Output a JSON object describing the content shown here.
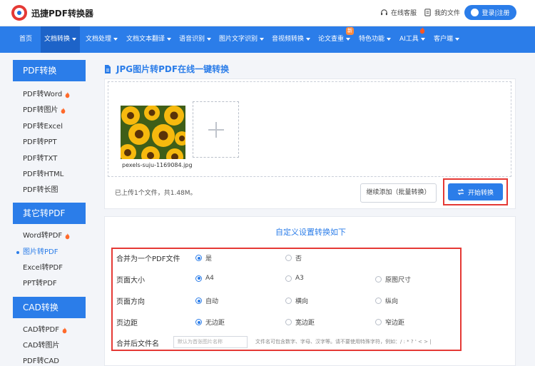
{
  "header": {
    "logo_text": "迅捷PDF转换器",
    "service_label": "在线客服",
    "my_files_label": "我的文件",
    "login_label": "登录|注册"
  },
  "nav": {
    "items": [
      {
        "label": "首页"
      },
      {
        "label": "文档转换"
      },
      {
        "label": "文档处理"
      },
      {
        "label": "文档文本翻译"
      },
      {
        "label": "语音识别"
      },
      {
        "label": "图片文字识别"
      },
      {
        "label": "音视频转换"
      },
      {
        "label": "论文查重"
      },
      {
        "label": "特色功能"
      },
      {
        "label": "AI工具"
      },
      {
        "label": "客户端"
      }
    ],
    "new_badge": "新"
  },
  "sidebar": {
    "sections": [
      {
        "title": "PDF转换",
        "items": [
          "PDF转Word",
          "PDF转图片",
          "PDF转Excel",
          "PDF转PPT",
          "PDF转TXT",
          "PDF转HTML",
          "PDF转长图"
        ]
      },
      {
        "title": "其它转PDF",
        "items": [
          "Word转PDF",
          "图片转PDF",
          "Excel转PDF",
          "PPT转PDF"
        ]
      },
      {
        "title": "CAD转换",
        "items": [
          "CAD转PDF",
          "CAD转图片",
          "PDF转CAD"
        ]
      }
    ]
  },
  "main": {
    "title": "JPG图片转PDF在线一键转换",
    "file_name": "pexels-suju-1169084.jpg",
    "upload_info": "已上传1个文件，共1.48M。",
    "continue_label": "继续添加（批量转换）",
    "start_label": "开始转换"
  },
  "settings": {
    "title": "自定义设置转换如下",
    "rows": [
      {
        "label": "合并为一个PDF文件",
        "options": [
          "是",
          "否"
        ]
      },
      {
        "label": "页面大小",
        "options": [
          "A4",
          "A3",
          "原图尺寸"
        ]
      },
      {
        "label": "页面方向",
        "options": [
          "自动",
          "横向",
          "纵向"
        ]
      },
      {
        "label": "页边距",
        "options": [
          "无边距",
          "宽边距",
          "窄边距"
        ]
      }
    ],
    "filename_label": "合并后文件名",
    "filename_placeholder": "默认为首张图片名称",
    "filename_hint": "文件名可包含数字、字母、汉字等。请不要使用特殊字符，例如：/ : * ? ' < > |"
  },
  "colors": {
    "primary": "#2b7de9",
    "highlight": "#e53935"
  }
}
